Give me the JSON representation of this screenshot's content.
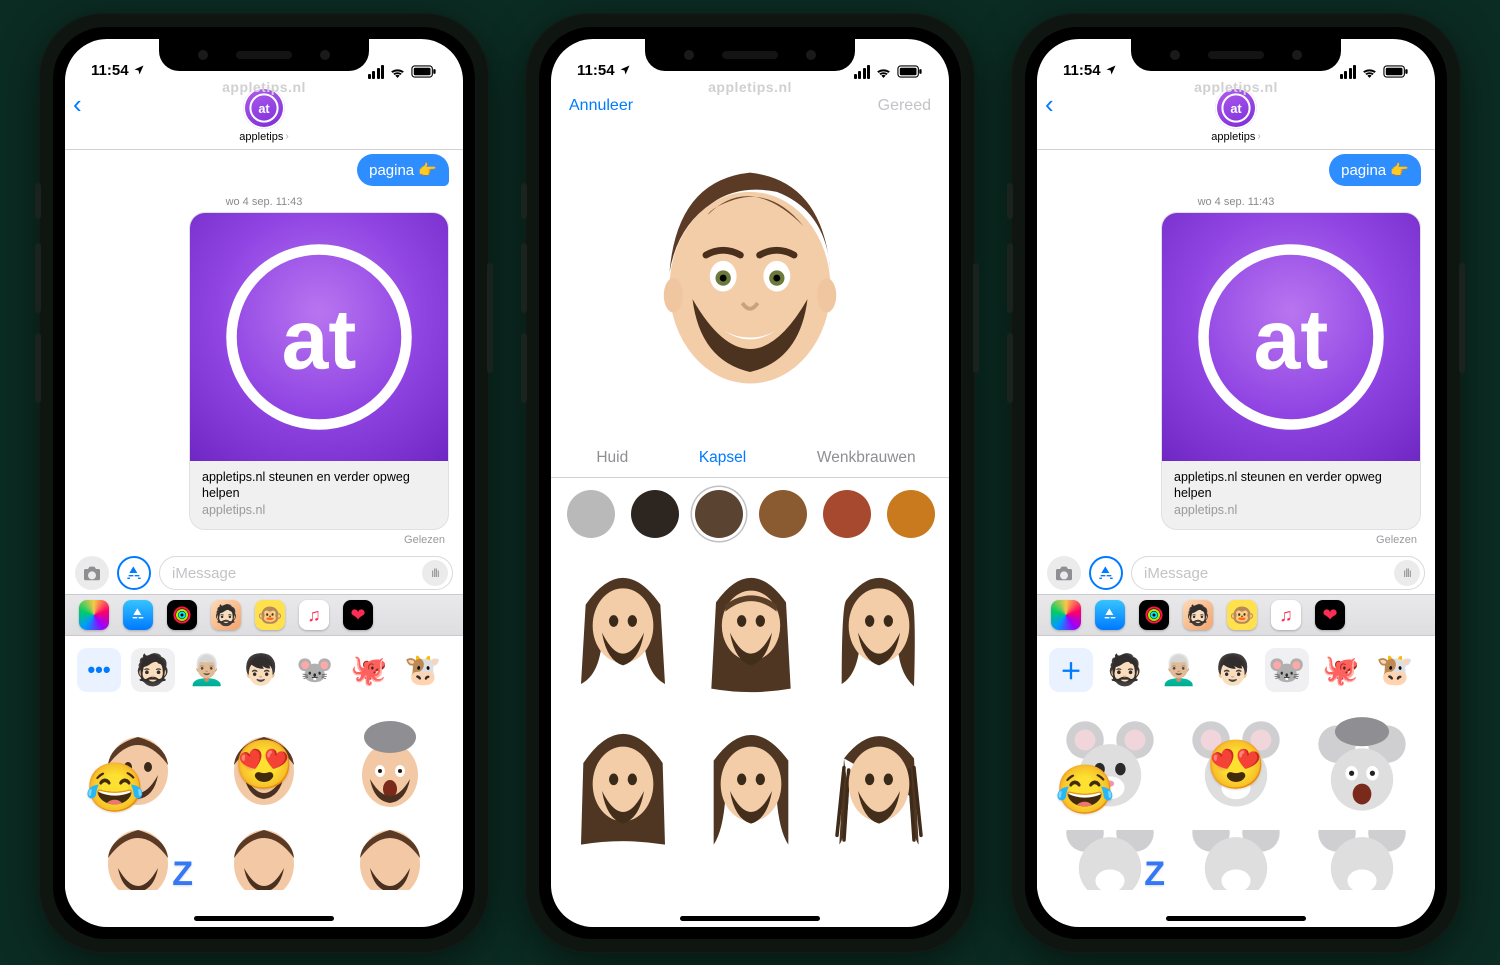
{
  "watermark": "appletips.nl",
  "status": {
    "time": "11:54"
  },
  "chat": {
    "contact_name": "appletips",
    "bubble_text": "pagina 👉",
    "timestamp": "wo 4 sep. 11:43",
    "link_title": "appletips.nl steunen en verder opweg helpen",
    "link_source": "appletips.nl",
    "receipt": "Gelezen",
    "compose_placeholder": "iMessage"
  },
  "memoji_row_left": {
    "button_label": "•••",
    "items": [
      "man-beard",
      "man-goggles",
      "man-cap",
      "mouse",
      "octopus",
      "cow"
    ]
  },
  "memoji_row_right": {
    "button_label": "＋",
    "items": [
      "man-beard",
      "man-goggles",
      "man-cap",
      "mouse",
      "octopus",
      "cow"
    ]
  },
  "editor": {
    "cancel": "Annuleer",
    "done": "Gereed",
    "tabs": {
      "skin": "Huid",
      "hair": "Kapsel",
      "brows": "Wenkbrauwen"
    },
    "swatches": [
      "#b9b9b9",
      "#2d2620",
      "#5a4331",
      "#8a5a30",
      "#a6492e",
      "#c97a1f"
    ],
    "selected_swatch_index": 2
  }
}
